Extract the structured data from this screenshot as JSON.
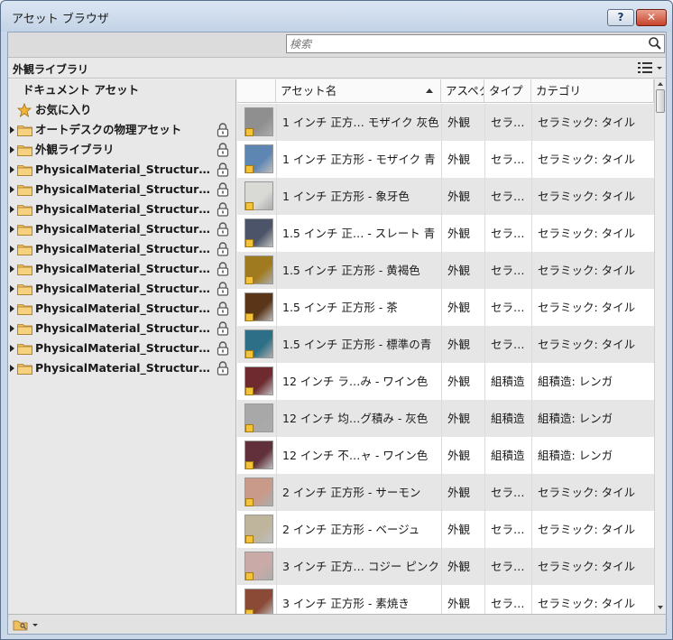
{
  "window": {
    "title": "アセット ブラウザ",
    "help_label": "?",
    "close_label": "✕"
  },
  "search": {
    "placeholder": "検索",
    "icon": "magnifier-icon"
  },
  "library_bar": {
    "title": "外観ライブラリ",
    "view_icon": "list-view-icon"
  },
  "tree": {
    "document_assets": "ドキュメント アセット",
    "favorites": "お気に入り",
    "items": [
      {
        "label": "オートデスクの物理アセット"
      },
      {
        "label": "外観ライブラリ"
      },
      {
        "label": "PhysicalMaterial_Structural_…"
      },
      {
        "label": "PhysicalMaterial_Structural_…"
      },
      {
        "label": "PhysicalMaterial_Structural_…"
      },
      {
        "label": "PhysicalMaterial_Structural_…"
      },
      {
        "label": "PhysicalMaterial_Structural_…"
      },
      {
        "label": "PhysicalMaterial_Structural_…"
      },
      {
        "label": "PhysicalMaterial_Structural_…"
      },
      {
        "label": "PhysicalMaterial_Structural_…"
      },
      {
        "label": "PhysicalMaterial_Structural_…"
      },
      {
        "label": "PhysicalMaterial_Structural_…"
      },
      {
        "label": "PhysicalMaterial_Structural_…"
      }
    ]
  },
  "table": {
    "columns": [
      "アセット名",
      "アスペクト",
      "タイプ",
      "カテゴリ"
    ],
    "rows": [
      {
        "name": "1 インチ 正方… モザイク 灰色",
        "aspect": "外観",
        "type": "セラ…",
        "category": "セラミック: タイル",
        "color": "#8f8f8f"
      },
      {
        "name": "1 インチ 正方形 - モザイク 青",
        "aspect": "外観",
        "type": "セラ…",
        "category": "セラミック: タイル",
        "color": "#5e86b3"
      },
      {
        "name": "1 インチ 正方形 - 象牙色",
        "aspect": "外観",
        "type": "セラ…",
        "category": "セラミック: タイル",
        "color": "#d9d9d6"
      },
      {
        "name": "1.5 インチ 正… - スレート 青",
        "aspect": "外観",
        "type": "セラ…",
        "category": "セラミック: タイル",
        "color": "#4b5468"
      },
      {
        "name": "1.5 インチ 正方形 - 黄褐色",
        "aspect": "外観",
        "type": "セラ…",
        "category": "セラミック: タイル",
        "color": "#a07a1e"
      },
      {
        "name": "1.5 インチ 正方形 - 茶",
        "aspect": "外観",
        "type": "セラ…",
        "category": "セラミック: タイル",
        "color": "#5a3517"
      },
      {
        "name": "1.5 インチ 正方形 - 標準の青",
        "aspect": "外観",
        "type": "セラ…",
        "category": "セラミック: タイル",
        "color": "#2c6f86"
      },
      {
        "name": "12 インチ ラ…み - ワイン色",
        "aspect": "外観",
        "type": "組積造",
        "category": "組積造: レンガ",
        "color": "#6e2a2f"
      },
      {
        "name": "12 インチ 均…グ積み - 灰色",
        "aspect": "外観",
        "type": "組積造",
        "category": "組積造: レンガ",
        "color": "#a8a8a8"
      },
      {
        "name": "12 インチ 不…ャ - ワイン色",
        "aspect": "外観",
        "type": "組積造",
        "category": "組積造: レンガ",
        "color": "#62303a"
      },
      {
        "name": "2 インチ 正方形 - サーモン",
        "aspect": "外観",
        "type": "セラ…",
        "category": "セラミック: タイル",
        "color": "#c99a8a"
      },
      {
        "name": "2 インチ 正方形 - ベージュ",
        "aspect": "外観",
        "type": "セラ…",
        "category": "セラミック: タイル",
        "color": "#bfb49c"
      },
      {
        "name": "3 インチ 正方… コジー ピンク",
        "aspect": "外観",
        "type": "セラ…",
        "category": "セラミック: タイル",
        "color": "#c9aaa6"
      },
      {
        "name": "3 インチ 正方形 - 素焼き",
        "aspect": "外観",
        "type": "セラ…",
        "category": "セラミック: タイル",
        "color": "#8b4a36"
      }
    ]
  },
  "status": {
    "icon": "folder-key-icon"
  }
}
